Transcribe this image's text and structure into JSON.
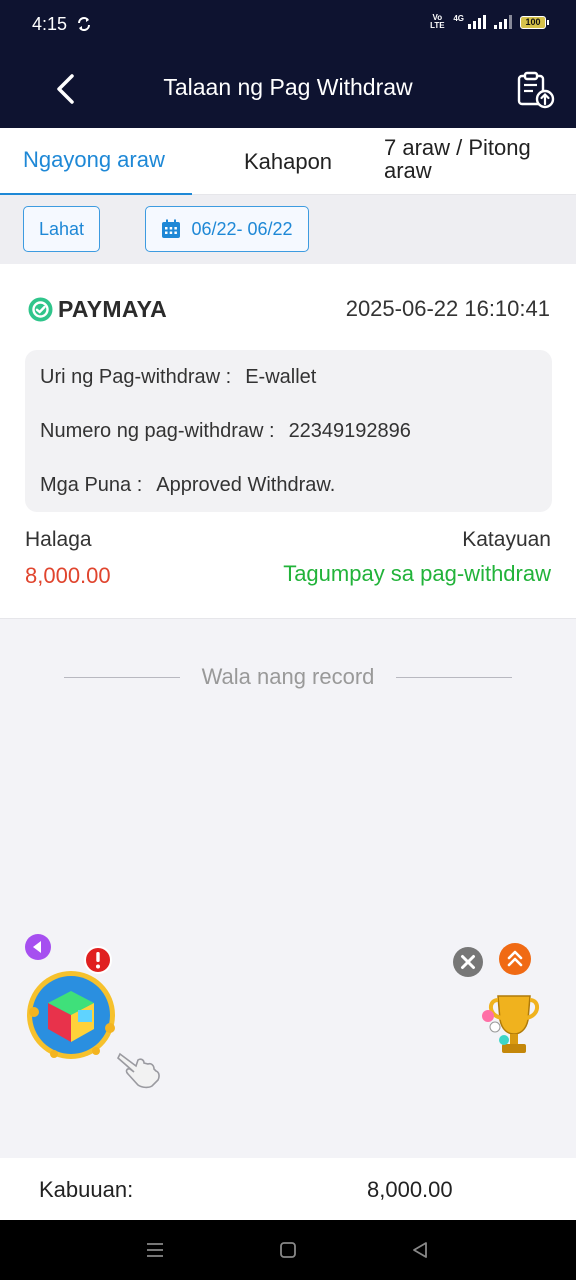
{
  "status_bar": {
    "time": "4:15",
    "volte": "Vo LTE",
    "network": "4G",
    "battery": "100"
  },
  "header": {
    "title": "Talaan ng Pag Withdraw",
    "back_icon": "chevron-left-icon",
    "export_icon": "clipboard-upload-icon"
  },
  "tabs": [
    {
      "label": "Ngayong araw",
      "active": true
    },
    {
      "label": "Kahapon",
      "active": false
    },
    {
      "label": "7 araw / Pitong araw",
      "active": false
    }
  ],
  "filters": {
    "all_label": "Lahat",
    "date_range": "06/22- 06/22"
  },
  "record": {
    "provider": "PAYMAYA",
    "datetime": "2025-06-22 16:10:41",
    "type_label": "Uri ng Pag-withdraw :",
    "type_value": "E-wallet",
    "number_label": "Numero ng pag-withdraw :",
    "number_value": "22349192896",
    "remarks_label": "Mga Puna :",
    "remarks_value": "Approved Withdraw.",
    "amount_label": "Halaga",
    "amount_value": "8,000.00",
    "status_label": "Katayuan",
    "status_value": "Tagumpay sa pag-withdraw"
  },
  "no_more_text": "Wala nang record",
  "total": {
    "label": "Kabuuan:",
    "value": "8,000.00"
  },
  "colors": {
    "header_bg": "#0e1330",
    "accent": "#1e88d6",
    "amount": "#e0452e",
    "success": "#22b33a"
  }
}
